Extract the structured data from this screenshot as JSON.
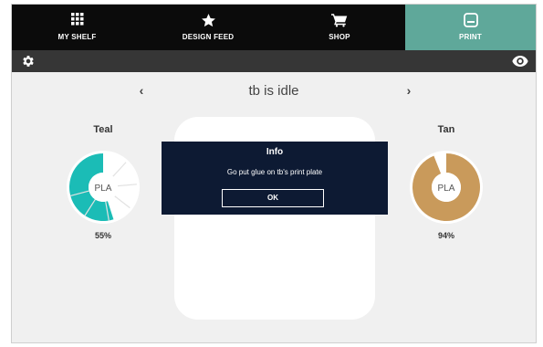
{
  "nav": {
    "tabs": [
      {
        "label": "MY SHELF",
        "icon": "grid-icon"
      },
      {
        "label": "DESIGN FEED",
        "icon": "star-icon"
      },
      {
        "label": "SHOP",
        "icon": "cart-icon"
      },
      {
        "label": "PRINT",
        "icon": "printer-icon"
      }
    ],
    "active_tab": "PRINT",
    "active_color": "#5fa89a"
  },
  "toolbar": {
    "left_icon": "gear-icon",
    "right_icon": "eye-icon"
  },
  "status": {
    "text": "tb is idle",
    "prev_arrow": "‹",
    "next_arrow": "›"
  },
  "spools": {
    "left": {
      "name": "Teal",
      "material": "PLA",
      "percent_label": "55%",
      "fill_fraction": 0.55,
      "color": "#1bbcb6"
    },
    "right": {
      "name": "Tan",
      "material": "PLA",
      "percent_label": "94%",
      "fill_fraction": 0.94,
      "color": "#c99a5b"
    }
  },
  "dialog": {
    "title": "Info",
    "message": "Go put glue on tb's print plate",
    "ok_label": "OK"
  }
}
